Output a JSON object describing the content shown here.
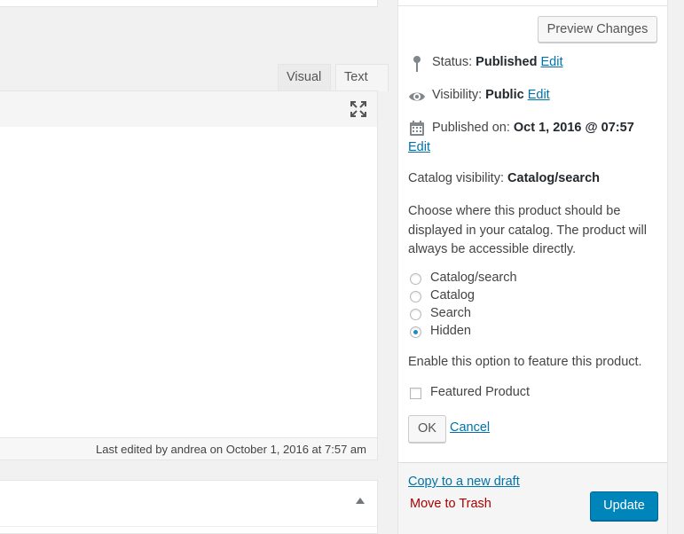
{
  "editor": {
    "tabs": [
      {
        "label": "Visual"
      },
      {
        "label": "Text"
      }
    ],
    "fullscreen_icon": "expand-icon",
    "last_edited": "Last edited by andrea on October 1, 2016 at 7:57 am"
  },
  "publish": {
    "preview_label": "Preview Changes",
    "status_label": "Status:",
    "status_value": "Published",
    "visibility_label": "Visibility:",
    "visibility_value": "Public",
    "published_label": "Published on:",
    "published_value": "Oct 1, 2016 @ 07:57",
    "edit_label": "Edit",
    "catalog_visibility_label": "Catalog visibility:",
    "catalog_visibility_value": "Catalog/search",
    "catalog_description": "Choose where this product should be displayed in your catalog. The product will always be accessible directly.",
    "catalog_options": [
      {
        "label": "Catalog/search",
        "checked": false
      },
      {
        "label": "Catalog",
        "checked": false
      },
      {
        "label": "Search",
        "checked": false
      },
      {
        "label": "Hidden",
        "checked": true
      }
    ],
    "feature_description": "Enable this option to feature this product.",
    "featured_label": "Featured Product",
    "featured_checked": false,
    "ok_label": "OK",
    "cancel_label": "Cancel",
    "copy_draft_label": "Copy to a new draft",
    "trash_label": "Move to Trash",
    "update_label": "Update"
  },
  "colors": {
    "accent": "#0073aa",
    "primary_button": "#0085ba",
    "trash": "#aa0000"
  }
}
